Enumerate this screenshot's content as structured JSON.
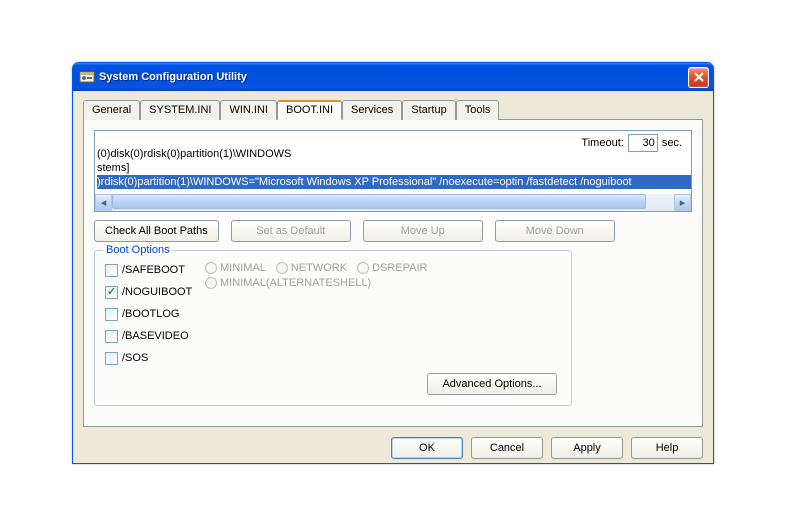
{
  "window": {
    "title": "System Configuration Utility"
  },
  "tabs": [
    "General",
    "SYSTEM.INI",
    "WIN.INI",
    "BOOT.INI",
    "Services",
    "Startup",
    "Tools"
  ],
  "activeTab": "BOOT.INI",
  "list": {
    "line0": "",
    "line1": "(0)disk(0)rdisk(0)partition(1)\\WINDOWS",
    "line2": "stems]",
    "line3": ")rdisk(0)partition(1)\\WINDOWS=\"Microsoft Windows XP Professional\" /noexecute=optin /fastdetect /noguiboot"
  },
  "buttons": {
    "checkAll": "Check All Boot Paths",
    "setDefault": "Set as Default",
    "moveUp": "Move Up",
    "moveDown": "Move Down",
    "advanced": "Advanced Options...",
    "ok": "OK",
    "cancel": "Cancel",
    "apply": "Apply",
    "help": "Help"
  },
  "bootOptions": {
    "legend": "Boot Options",
    "safeboot": "/SAFEBOOT",
    "noguiboot": "/NOGUIBOOT",
    "bootlog": "/BOOTLOG",
    "basevideo": "/BASEVIDEO",
    "sos": "/SOS",
    "minimal": "MINIMAL",
    "network": "NETWORK",
    "dsrepair": "DSREPAIR",
    "minimalalt": "MINIMAL(ALTERNATESHELL)"
  },
  "timeout": {
    "label": "Timeout:",
    "value": "30",
    "unit": "sec."
  }
}
